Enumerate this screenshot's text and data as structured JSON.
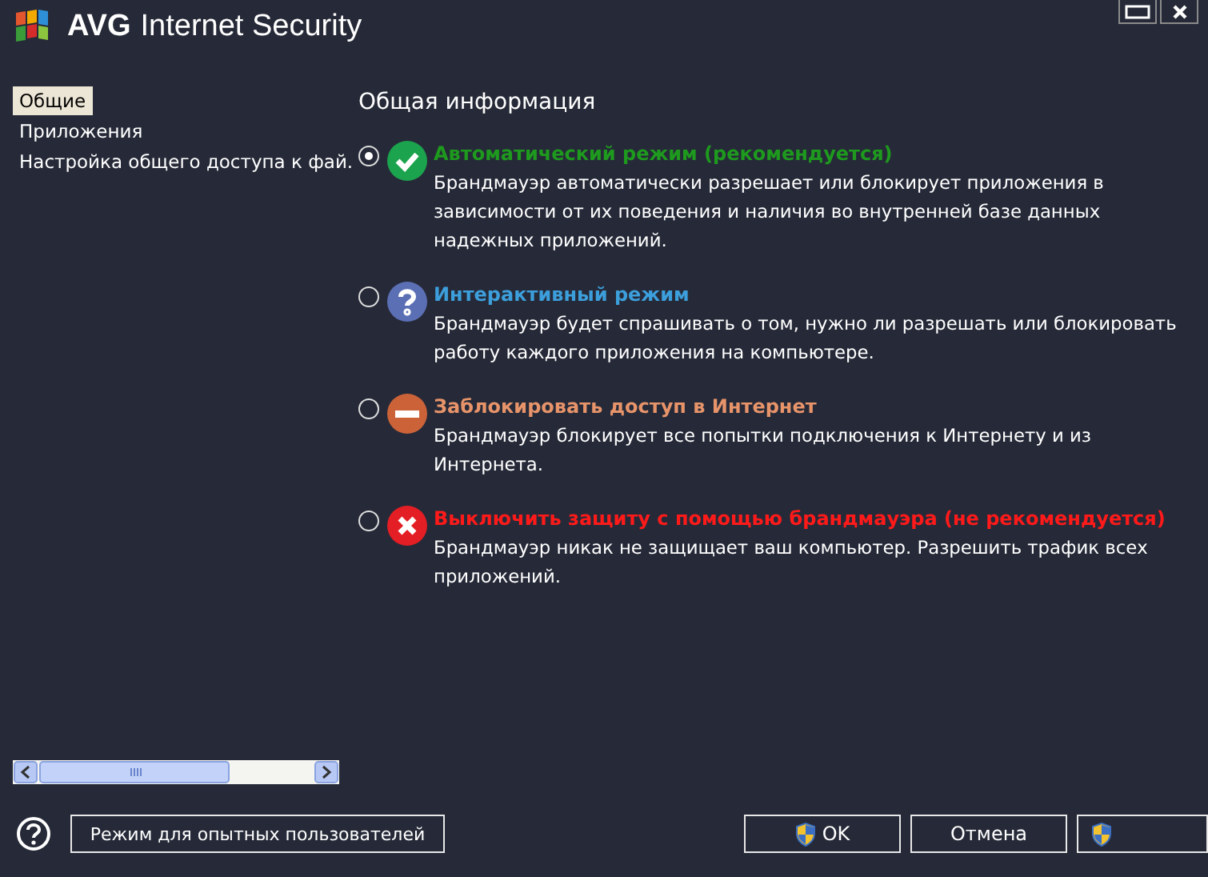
{
  "window": {
    "brand": "AVG",
    "title": "Internet Security"
  },
  "sidebar": {
    "items": [
      {
        "label": "Общие",
        "selected": true
      },
      {
        "label": "Приложения",
        "selected": false
      },
      {
        "label": "Настройка общего доступа к фай.",
        "selected": false
      }
    ]
  },
  "content": {
    "heading": "Общая информация",
    "modes": [
      {
        "kind": "check",
        "title": "Автоматический режим (рекомендуется)",
        "color": "#1e9a1e",
        "description": "Брандмауэр автоматически разрешает или блокирует приложения в зависимости от их поведения и наличия во внутренней базе данных надежных приложений.",
        "selected": true
      },
      {
        "kind": "question",
        "title": "Интерактивный режим",
        "color": "#3c9fdc",
        "description": "Брандмауэр будет спрашивать о том, нужно ли разрешать или блокировать работу каждого приложения на компьютере.",
        "selected": false
      },
      {
        "kind": "block",
        "title": "Заблокировать доступ в Интернет",
        "color": "#e8946a",
        "description": "Брандмауэр блокирует все попытки подключения к Интернету и из Интернета.",
        "selected": false
      },
      {
        "kind": "cross",
        "title": "Выключить защиту с помощью брандмауэра (не рекомендуется)",
        "color": "#ff1a1a",
        "description": "Брандмауэр никак не защищает ваш компьютер. Разрешить трафик всех приложений.",
        "selected": false
      }
    ]
  },
  "footer": {
    "expert_button": "Режим для опытных пользователей",
    "buttons": [
      {
        "label": "OK",
        "shield": true
      },
      {
        "label": "Отмена",
        "shield": false
      }
    ]
  }
}
